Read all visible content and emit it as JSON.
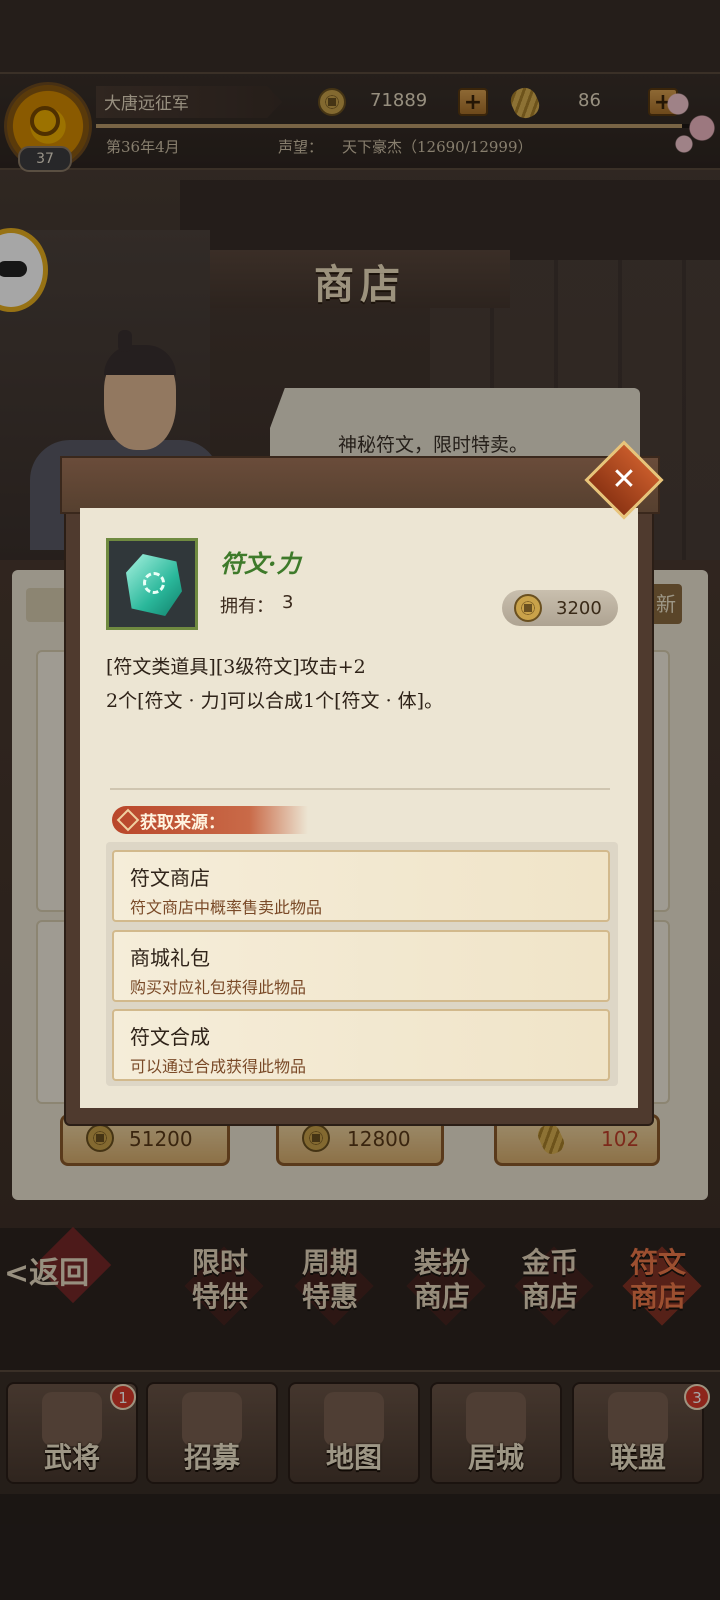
{
  "header": {
    "player_name": "大唐远征军",
    "level": "37",
    "date": "第36年4月",
    "prestige_label": "声望：",
    "prestige_value": "天下豪杰（12690/12999）",
    "prestige_progress": 0.976,
    "coins": "71889",
    "ingots": "86",
    "plus_label": "+"
  },
  "shop": {
    "title": "商店",
    "dialogue": "神秘符文，限时特卖。",
    "refresh_tab": "新",
    "prices": [
      "51200",
      "12800",
      "102"
    ]
  },
  "item_dialog": {
    "close_label": "✕",
    "item_name": "符文·力",
    "own_label": "拥有：",
    "own_count": "3",
    "price": "3200",
    "description_line1": "[符文类道具][3级符文]攻击+2",
    "description_line2": "2个[符文 · 力]可以合成1个[符文 · 体]。",
    "sources_title": "获取来源：",
    "sources": [
      {
        "title": "符文商店",
        "desc": "符文商店中概率售卖此物品"
      },
      {
        "title": "商城礼包",
        "desc": "购买对应礼包获得此物品"
      },
      {
        "title": "符文合成",
        "desc": "可以通过合成获得此物品"
      }
    ]
  },
  "category_tabs": {
    "back_label": "<返回",
    "tabs": [
      {
        "line1": "限时",
        "line2": "特供"
      },
      {
        "line1": "周期",
        "line2": "特惠"
      },
      {
        "line1": "装扮",
        "line2": "商店"
      },
      {
        "line1": "金币",
        "line2": "商店"
      },
      {
        "line1": "符文",
        "line2": "商店"
      }
    ]
  },
  "bottom_nav": {
    "items": [
      {
        "label": "武将",
        "badge": "1"
      },
      {
        "label": "招募",
        "badge": ""
      },
      {
        "label": "地图",
        "badge": ""
      },
      {
        "label": "居城",
        "badge": ""
      },
      {
        "label": "联盟",
        "badge": "3"
      }
    ]
  },
  "colors": {
    "rune_green": "#2ab79a",
    "item_name_green": "#3e7a2a",
    "source_ribbon": "#b9462a",
    "active_tab": "#f07a4a",
    "badge_red": "#d93a2a"
  },
  "icons": {
    "coin": "copper-coin-icon",
    "ingot": "gold-ingot-icon",
    "close": "close-icon",
    "rune": "rune-stone-icon"
  }
}
